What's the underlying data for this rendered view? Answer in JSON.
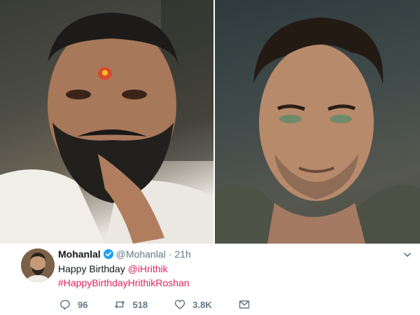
{
  "photos": {
    "left": {
      "subject": "bearded man with tilak, hand on chin"
    },
    "right": {
      "subject": "man with green eyes and stubble"
    }
  },
  "tweet": {
    "display_name": "Mohanlal",
    "handle": "@Mohanlal",
    "separator": "·",
    "time": "21h",
    "text_prefix": "Happy Birthday ",
    "mention": "@iHrithik",
    "hashtag": "#HappyBirthdayHrithikRoshan",
    "actions": {
      "reply_icon": "reply-icon",
      "reply_count": "96",
      "retweet_icon": "retweet-icon",
      "retweet_count": "518",
      "like_icon": "heart-icon",
      "like_count": "3.8K",
      "dm_icon": "mail-icon"
    }
  },
  "colors": {
    "verified": "#1da1f2",
    "link": "#e0245e",
    "muted": "#657786",
    "text": "#14171a"
  }
}
